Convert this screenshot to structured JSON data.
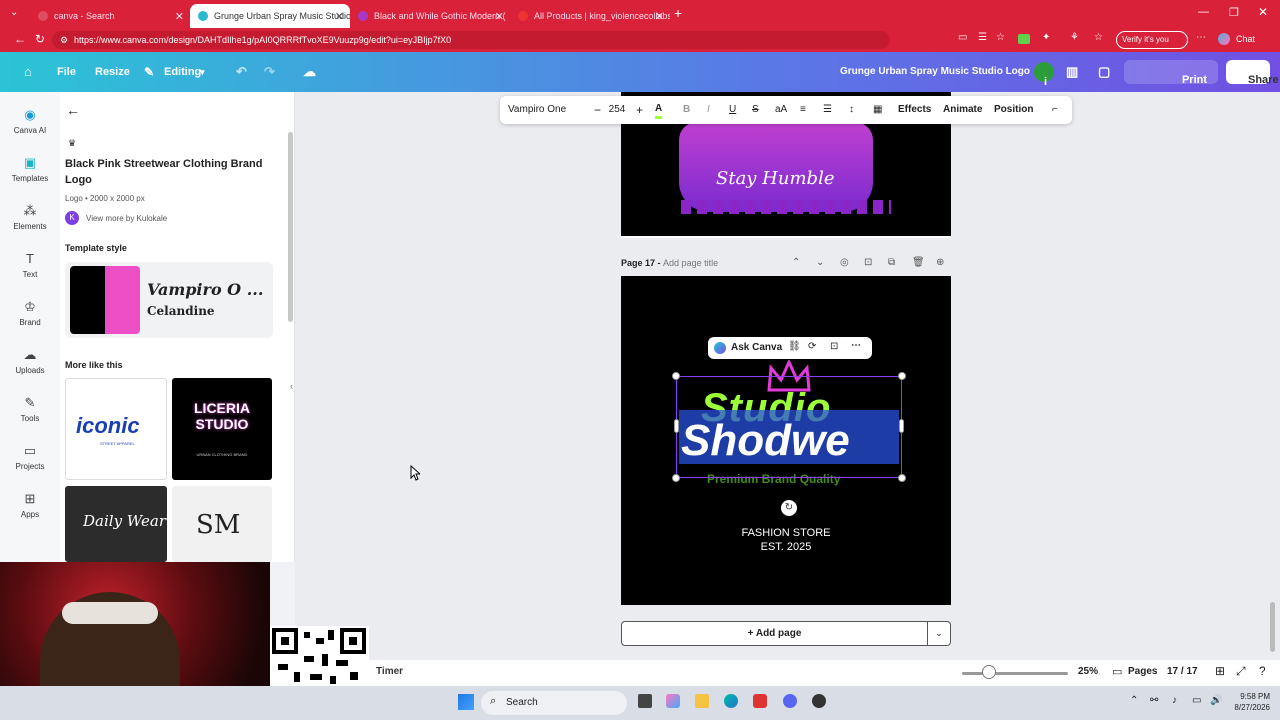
{
  "browser": {
    "tabs": [
      {
        "label": "canva - Search",
        "active": false
      },
      {
        "label": "Grunge Urban Spray Music Studio",
        "active": true
      },
      {
        "label": "Black and While Gothic Modern (",
        "active": false
      },
      {
        "label": "All Products | king_violencecollabs",
        "active": false
      }
    ],
    "url": "https://www.canva.com/design/DAHTdIlhe1g/pAI0QRRRfTvoXE9Vuuzp9g/edit?ui=eyJBIjp7fX0",
    "verify_label": "Verify it's you",
    "chat_label": "Chat"
  },
  "header": {
    "file": "File",
    "resize": "Resize",
    "editing": "Editing",
    "doc_title": "Grunge Urban Spray Music Studio Logo",
    "avatar_initial": "i",
    "print": "Print with Canva",
    "share": "Share"
  },
  "rail": [
    {
      "label": "Canva AI"
    },
    {
      "label": "Templates"
    },
    {
      "label": "Elements"
    },
    {
      "label": "Text"
    },
    {
      "label": "Brand"
    },
    {
      "label": "Uploads"
    },
    {
      "label": "Tools"
    },
    {
      "label": "Projects"
    },
    {
      "label": "Apps"
    }
  ],
  "panel": {
    "template_title": "Black Pink Streetwear Clothing Brand Logo",
    "template_meta": "Logo • 2000 x 2000 px",
    "author_initial": "K",
    "author_link": "View more by Kulokale",
    "style_heading": "Template style",
    "font1": "Vampiro O ...",
    "font2": "Celandine",
    "more_heading": "More like this",
    "thumbs": [
      {
        "text": "iconic",
        "sub": "STREET APPAREL"
      },
      {
        "text": "LICERIA STUDIO",
        "sub": "URBAN CLOTHING BRAND"
      },
      {
        "text": "Daily Wear"
      },
      {
        "text": "SM"
      }
    ],
    "colors": {
      "black": "#000000",
      "pink": "#ee4fc6"
    }
  },
  "toolbar": {
    "font": "Vampiro One",
    "size": "254",
    "effects": "Effects",
    "animate": "Animate",
    "position": "Position"
  },
  "pages": {
    "page16_text": "Stay Humble",
    "page17_label": "Page 17 -",
    "page17_title_placeholder": "Add page title",
    "ask_canva": "Ask Canva",
    "logo_top": "Studio",
    "logo_main": "Shodwe",
    "logo_tag": "Premium Brand Quality",
    "store_line1": "FASHION STORE",
    "store_line2": "EST. 2025",
    "add_page": "+ Add page"
  },
  "footer": {
    "timer": "Timer",
    "zoom_level": 0.25,
    "zoom": "25%",
    "pages_label": "Pages",
    "page_count": "17 / 17"
  },
  "taskbar": {
    "search": "Search",
    "time": "9:58 PM",
    "date": "8/27/2026"
  },
  "colors": {
    "brand_gradient_start": "#2bc4d6",
    "brand_gradient_end": "#7150e3",
    "browser_red": "#d9213a",
    "selection": "#8b3dff",
    "logo_green": "#9dff3a",
    "logo_pink": "#e23bd8"
  }
}
